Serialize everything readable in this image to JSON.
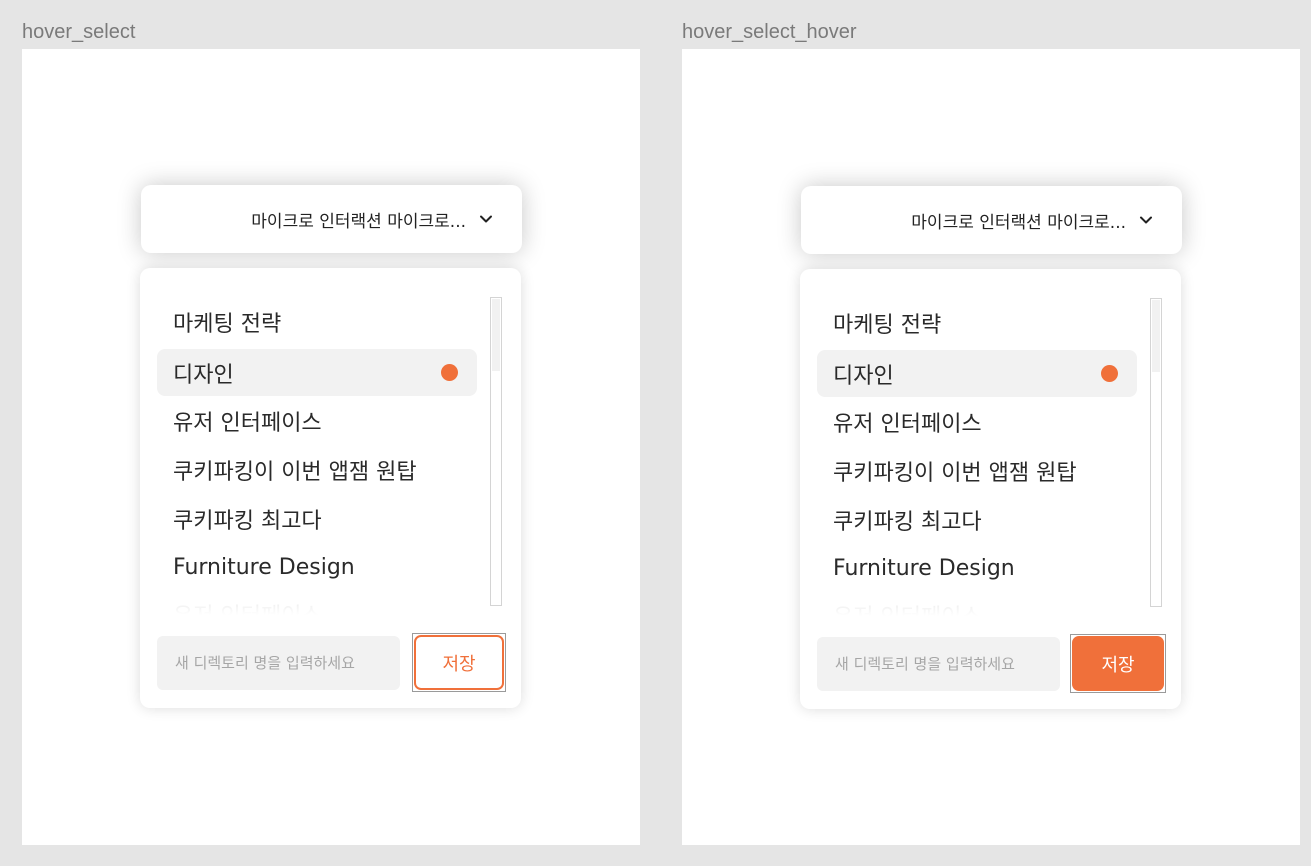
{
  "colors": {
    "accent": "#f0703a",
    "selected_bg": "#f2f2f2",
    "canvas_bg": "#e5e5e5",
    "frame_bg": "#ffffff"
  },
  "frames": [
    {
      "label": "hover_select",
      "selected_value": "마이크로 인터랙션 마이크로...",
      "chevron_icon": "chevron-down-icon",
      "items": [
        {
          "label": "마케팅 전략",
          "selected": false
        },
        {
          "label": "디자인",
          "selected": true
        },
        {
          "label": "유저 인터페이스",
          "selected": false
        },
        {
          "label": "쿠키파킹이 이번 앱잼 원탑",
          "selected": false
        },
        {
          "label": "쿠키파킹 최고다",
          "selected": false
        },
        {
          "label": "Furniture Design",
          "selected": false
        },
        {
          "label": "유저 인터페이스",
          "selected": false
        }
      ],
      "input_placeholder": "새 디렉토리 명을 입력하세요",
      "save_label": "저장",
      "save_state": "default"
    },
    {
      "label": "hover_select_hover",
      "selected_value": "마이크로 인터랙션 마이크로...",
      "chevron_icon": "chevron-down-icon",
      "items": [
        {
          "label": "마케팅 전략",
          "selected": false
        },
        {
          "label": "디자인",
          "selected": true
        },
        {
          "label": "유저 인터페이스",
          "selected": false
        },
        {
          "label": "쿠키파킹이 이번 앱잼 원탑",
          "selected": false
        },
        {
          "label": "쿠키파킹 최고다",
          "selected": false
        },
        {
          "label": "Furniture Design",
          "selected": false
        },
        {
          "label": "유저 인터페이스",
          "selected": false
        }
      ],
      "input_placeholder": "새 디렉토리 명을 입력하세요",
      "save_label": "저장",
      "save_state": "hover"
    }
  ]
}
